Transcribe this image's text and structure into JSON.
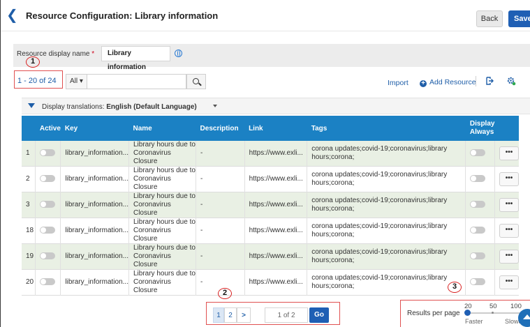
{
  "header": {
    "title": "Resource Configuration: Library information",
    "back_label": "Back",
    "save_label": "Save"
  },
  "resource": {
    "label": "Resource display name",
    "required_mark": "*",
    "value": "Library information"
  },
  "annotations": [
    "1",
    "2",
    "3"
  ],
  "toolbar": {
    "count": "1 - 20 of 24",
    "filter": "All",
    "search_value": "",
    "import_label": "Import",
    "add_label": "Add Resource"
  },
  "translations": {
    "label": "Display translations:",
    "value": "English (Default Language)"
  },
  "table": {
    "headers": {
      "active": "Active",
      "key": "Key",
      "name": "Name",
      "description": "Description",
      "link": "Link",
      "tags": "Tags",
      "display_always_1": "Display",
      "display_always_2": "Always"
    },
    "rows": [
      {
        "num": "1",
        "key": "library_information...",
        "name1": "Library hours due to",
        "name2": "Coronavirus Closure",
        "desc": "-",
        "link": "https://www.exli...",
        "tags1": "corona updates;covid-19;coronavirus;library",
        "tags2": "hours;corona;",
        "more": "•••"
      },
      {
        "num": "2",
        "key": "library_information...",
        "name1": "Library hours due to",
        "name2": "Coronavirus Closure",
        "desc": "-",
        "link": "https://www.exli...",
        "tags1": "corona updates;covid-19;coronavirus;library",
        "tags2": "hours;corona;",
        "more": "•••"
      },
      {
        "num": "3",
        "key": "library_information...",
        "name1": "Library hours due to",
        "name2": "Coronavirus Closure",
        "desc": "-",
        "link": "https://www.exli...",
        "tags1": "corona updates;covid-19;coronavirus;library",
        "tags2": "hours;corona;",
        "more": "•••"
      },
      {
        "num": "18",
        "key": "library_information...",
        "name1": "Library hours due to",
        "name2": "Coronavirus Closure",
        "desc": "-",
        "link": "https://www.exli...",
        "tags1": "corona updates;covid-19;coronavirus;library",
        "tags2": "hours;corona;",
        "more": "•••"
      },
      {
        "num": "19",
        "key": "library_information...",
        "name1": "Library hours due to",
        "name2": "Coronavirus Closure",
        "desc": "-",
        "link": "https://www.exli...",
        "tags1": "corona updates;covid-19;coronavirus;library",
        "tags2": "hours;corona;",
        "more": "•••"
      },
      {
        "num": "20",
        "key": "library_information...",
        "name1": "Library hours due to",
        "name2": "Coronavirus Closure",
        "desc": "-",
        "link": "https://www.exli...",
        "tags1": "corona updates;covid-19;coronavirus;library",
        "tags2": "hours;corona;",
        "more": "•••"
      }
    ]
  },
  "pagination": {
    "page1": "1",
    "page2": "2",
    "next": ">",
    "of": "1 of 2",
    "go": "Go"
  },
  "results_per_page": {
    "label": "Results per page",
    "options": [
      "20",
      "50",
      "100"
    ],
    "selected": "20",
    "faster": "Faster",
    "slower": "Slower"
  },
  "colors": {
    "header_bg": "#1b81c4",
    "primary": "#1f5fb4",
    "alt_row": "#e9f0e4",
    "annotation": "#d81d1d"
  },
  "icons": [
    "chevron-left-icon",
    "globe-icon",
    "search-icon",
    "plus-circle-icon",
    "export-icon",
    "gear-icon",
    "filter-icon",
    "chevron-down-icon",
    "arrow-up-icon"
  ]
}
